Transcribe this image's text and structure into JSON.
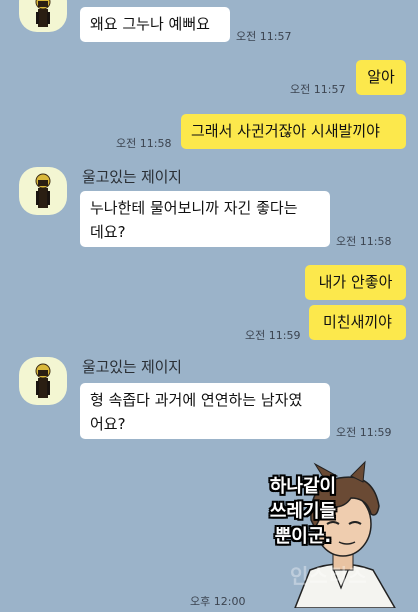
{
  "messages": {
    "m1": {
      "text": "왜요 그누나 예뻐요",
      "time": "오전 11:57"
    },
    "m2": {
      "text": "알아",
      "time": "오전 11:57"
    },
    "m3": {
      "text": "그래서 사귄거잖아 시새발끼야",
      "time": "오전 11:58"
    },
    "m4": {
      "sender": "울고있는 제이지",
      "text": "누나한테 물어보니까 자긴 좋다는\n데요?",
      "time": "오전 11:58"
    },
    "m5": {
      "text": "내가 안좋아"
    },
    "m6": {
      "text": "미친새끼야",
      "time": "오전 11:59"
    },
    "m7": {
      "sender": "울고있는 제이지",
      "text": "형 속좁다 과거에 연연하는 남자였\n어요?",
      "time": "오전 11:59"
    },
    "m8": {
      "caption": "하나같이\n쓰레기들\n뿐이군.",
      "watermark": "인스티즈",
      "time": "오후 12:00"
    }
  },
  "colors": {
    "background": "#9BB3C9",
    "incoming_bubble": "#FFFFFF",
    "outgoing_bubble": "#FCE84C",
    "avatar_bg": "#F3F6D2"
  },
  "icons": {
    "avatar": "crying-character-avatar"
  }
}
